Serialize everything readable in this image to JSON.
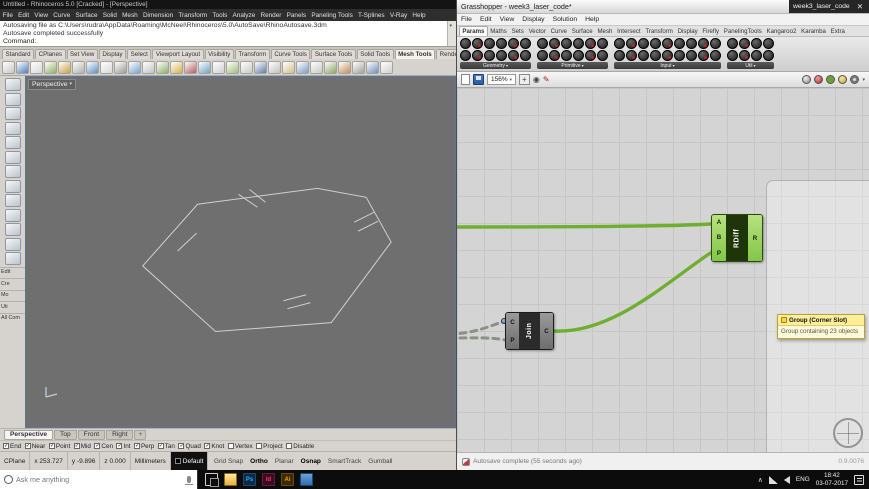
{
  "icons": {
    "close": "✕",
    "caret": "▾",
    "check": "✓",
    "add_tab": "+",
    "fit": "+",
    "eye": "◉",
    "pencil": "✎",
    "tray_caret": "∧"
  },
  "rhino": {
    "title": "Untitled - Rhinoceros 5.0 [Cracked] - [Perspective]",
    "menu": [
      "File",
      "Edit",
      "View",
      "Curve",
      "Surface",
      "Solid",
      "Mesh",
      "Dimension",
      "Transform",
      "Tools",
      "Analyze",
      "Render",
      "Panels",
      "Paneling Tools",
      "T-Splines",
      "V-Ray",
      "Help"
    ],
    "command_lines": [
      "Autosaving file as C:\\Users\\rudra\\AppData\\Roaming\\McNeel\\Rhinoceros\\5.0\\AutoSave\\RhinoAutosave.3dm",
      "Autosave completed successfully"
    ],
    "command_prompt": "Command:",
    "toolbar_tabs": [
      "Standard",
      "CPlanes",
      "Set View",
      "Display",
      "Select",
      "Viewport Layout",
      "Visibility",
      "Transform",
      "Curve Tools",
      "Surface Tools",
      "Solid Tools",
      "Mesh Tools",
      "Render"
    ],
    "active_toolbar_tab": "Mesh Tools",
    "sidebar_labels": [
      "Edit",
      "Cre",
      "Mo",
      "Uti",
      "All Com"
    ],
    "viewport": {
      "label": "Perspective"
    },
    "viewport_tabs": [
      "Perspective",
      "Top",
      "Front",
      "Right"
    ],
    "osnap": [
      {
        "label": "End",
        "checked": true
      },
      {
        "label": "Near",
        "checked": true
      },
      {
        "label": "Point",
        "checked": true
      },
      {
        "label": "Mid",
        "checked": true
      },
      {
        "label": "Cen",
        "checked": true
      },
      {
        "label": "Int",
        "checked": true
      },
      {
        "label": "Perp",
        "checked": true
      },
      {
        "label": "Tan",
        "checked": true
      },
      {
        "label": "Quad",
        "checked": true
      },
      {
        "label": "Knot",
        "checked": true
      },
      {
        "label": "Vertex",
        "checked": false
      },
      {
        "label": "Project",
        "checked": false
      },
      {
        "label": "Disable",
        "checked": false
      }
    ],
    "status": {
      "cplane": "CPlane",
      "x": "x 253.727",
      "y": "y -9.896",
      "z": "z 0.000",
      "units": "Millimeters",
      "layer": "Default",
      "toggles": [
        {
          "label": "Grid Snap",
          "active": false
        },
        {
          "label": "Ortho",
          "active": true
        },
        {
          "label": "Planar",
          "active": false
        },
        {
          "label": "Osnap",
          "active": true
        },
        {
          "label": "SmartTrack",
          "active": false
        },
        {
          "label": "Gumball",
          "active": false
        }
      ]
    }
  },
  "grasshopper": {
    "title": "Grasshopper - week3_laser_code*",
    "doc_name": "week3_laser_code",
    "menu": [
      "File",
      "Edit",
      "View",
      "Display",
      "Solution",
      "Help"
    ],
    "tabs": [
      "Params",
      "Maths",
      "Sets",
      "Vector",
      "Curve",
      "Surface",
      "Mesh",
      "Intersect",
      "Transform",
      "Display",
      "Firefly",
      "PanelingTools",
      "Kangaroo2",
      "Karamba",
      "Extra"
    ],
    "active_tab": "Params",
    "palette_groups": [
      "Geometry",
      "Primitive",
      "Input",
      "Util"
    ],
    "toolbar": {
      "zoom": "156%"
    },
    "components": {
      "rdiff": {
        "label": "RDiff",
        "inputs": [
          "A",
          "B",
          "P"
        ],
        "outputs": [
          "R"
        ]
      },
      "join": {
        "label": "Join",
        "inputs": [
          "C",
          "P"
        ],
        "outputs": [
          "C"
        ]
      }
    },
    "tooltip": {
      "title": "Group (Corner Slot)",
      "body": "Group containing 23 objects"
    },
    "status": "Autosave complete (55 seconds ago)",
    "version": "0.9.0076",
    "colors": {
      "wire_green": "#6fae2f",
      "selected_green": "#8ed34f"
    }
  },
  "taskbar": {
    "search_placeholder": "Ask me anything",
    "apps": [
      {
        "name": "task-view",
        "label": ""
      },
      {
        "name": "file-explorer",
        "label": ""
      },
      {
        "name": "photoshop",
        "label": "Ps"
      },
      {
        "name": "indesign",
        "label": "Id"
      },
      {
        "name": "illustrator",
        "label": "Ai"
      },
      {
        "name": "generic-app",
        "label": ""
      }
    ],
    "tray": {
      "lang": "ENG",
      "time": "18:42",
      "date": "03-07-2017"
    }
  }
}
